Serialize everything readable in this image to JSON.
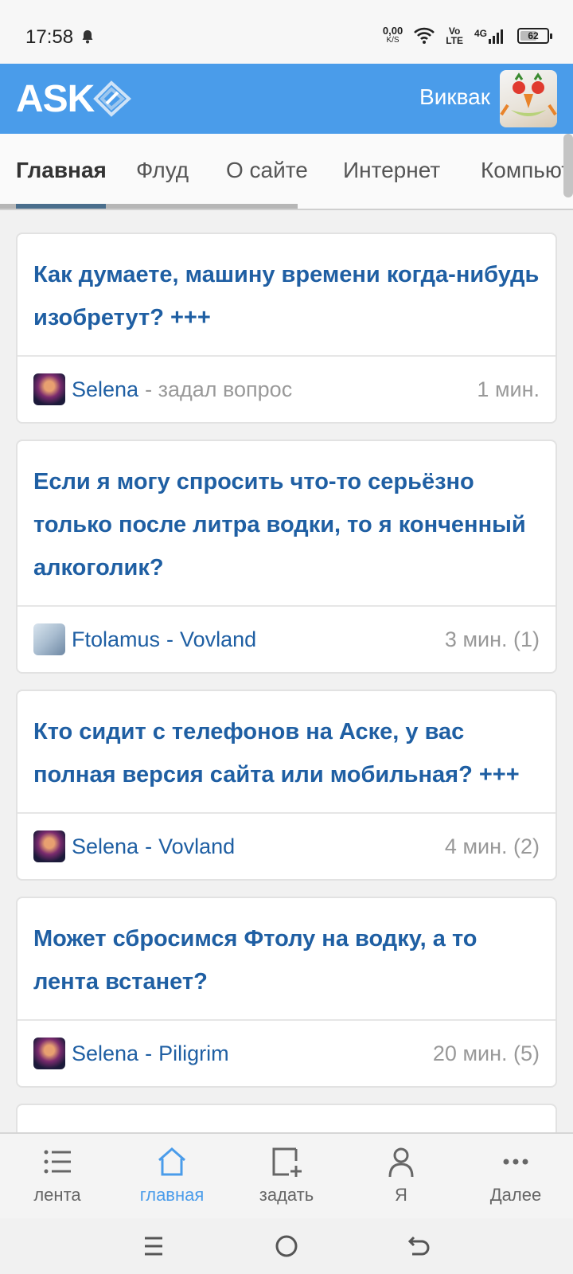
{
  "status_bar": {
    "time": "17:58",
    "net_speed_value": "0,00",
    "net_speed_unit": "K/S",
    "volte_top": "Vo",
    "volte_bottom": "LTE",
    "network": "4G",
    "battery_level": "62",
    "battery_fraction": 0.62
  },
  "header": {
    "logo": "ASK",
    "user_name": "Виквак"
  },
  "tabs": [
    {
      "label": "Главная",
      "active": true
    },
    {
      "label": "Флуд",
      "active": false
    },
    {
      "label": "О сайте",
      "active": false
    },
    {
      "label": "Интернет",
      "active": false
    },
    {
      "label": "Компьютеры",
      "active": false
    }
  ],
  "feed": [
    {
      "title": "Как думаете, машину времени когда-нибудь изобретут? +++",
      "user": "Selena",
      "action": "- задал вопрос",
      "target": "",
      "time": "1 мин."
    },
    {
      "title": "Если я могу спросить что-то серьёзно только после литра водки, то я конченный алкоголик?",
      "user": "Ftolamus",
      "action": "",
      "separator": "-",
      "target": "Vovland",
      "time": "3 мин. (1)"
    },
    {
      "title": "Кто сидит с телефонов на Аске, у вас полная версия сайта или мобильная? +++",
      "user": "Selena",
      "action": "",
      "separator": "-",
      "target": "Vovland",
      "time": "4 мин. (2)"
    },
    {
      "title": "Может сбросимся Фтолу на водку, а то лента встанет?",
      "user": "Selena",
      "action": "",
      "separator": "-",
      "target": "Piligrim",
      "time": "20 мин. (5)"
    }
  ],
  "bottom_nav": [
    {
      "label": "лента",
      "icon": "list-icon",
      "active": false
    },
    {
      "label": "главная",
      "icon": "home-icon",
      "active": true
    },
    {
      "label": "задать",
      "icon": "add-question-icon",
      "active": false
    },
    {
      "label": "Я",
      "icon": "profile-icon",
      "active": false
    },
    {
      "label": "Далее",
      "icon": "more-icon",
      "active": false
    }
  ],
  "colors": {
    "header_bg": "#4a9cea",
    "link_blue": "#1f5fa3",
    "muted": "#999999"
  }
}
